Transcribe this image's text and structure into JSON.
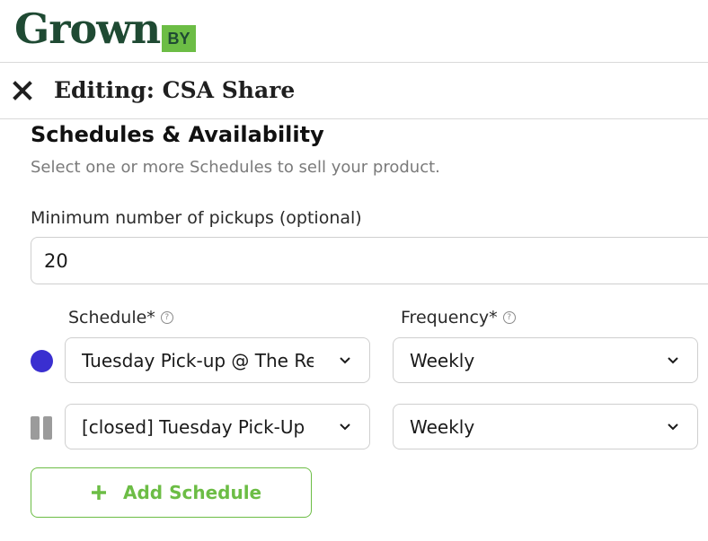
{
  "brand": {
    "logo_word": "Grown",
    "logo_by": "BY",
    "primary_color": "#1f4a33",
    "accent_color": "#6cbd45"
  },
  "header": {
    "title": "Editing: CSA Share",
    "close_icon": "close-icon"
  },
  "section": {
    "title": "Schedules & Availability",
    "subtitle": "Select one or more Schedules to sell your product."
  },
  "min_pickups": {
    "label": "Minimum number of pickups (optional)",
    "value": "20"
  },
  "columns": {
    "schedule_label": "Schedule*",
    "frequency_label": "Frequency*",
    "help_icon": "question-circle-icon"
  },
  "schedules": [
    {
      "indicator": "color-dot",
      "indicator_color": "#3a2fd0",
      "schedule": "Tuesday Pick-up @ The Re",
      "frequency": "Weekly"
    },
    {
      "indicator": "pause-icon",
      "indicator_color": "#9b9b9b",
      "schedule": "[closed] Tuesday Pick-Up",
      "frequency": "Weekly"
    }
  ],
  "add_button": {
    "label": "Add Schedule",
    "icon": "plus-icon"
  }
}
